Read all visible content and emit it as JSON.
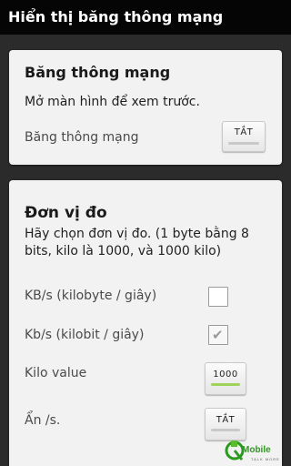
{
  "header": {
    "title": "Hiển thị băng thông mạng"
  },
  "bandwidth_card": {
    "title": "Băng thông mạng",
    "description": "Mở màn hình để xem trước.",
    "toggle_label": "Băng thông mạng",
    "toggle_button": "TẮT"
  },
  "units_card": {
    "title": "Đơn vị đo",
    "description": "Hãy chọn đơn vị đo. (1 byte bằng 8 bits, kilo là 1000, và 1000 kilo)",
    "rows": [
      {
        "label": "KB/s (kilobyte / giây)",
        "checked": false
      },
      {
        "label": "Kb/s (kilobit / giây)",
        "checked": true
      },
      {
        "label": "Kilo value",
        "value": "1000"
      },
      {
        "label": "Ẩn /s.",
        "value": "TẮT"
      }
    ]
  },
  "watermark": {
    "brand": "Mobile",
    "tagline": "TALK MORE"
  },
  "colors": {
    "titlebar": "#050505",
    "card": "#f2f2f2",
    "background": "#2b2b2b",
    "accent_green": "#9fd35a",
    "watermark_green": "#2c9a1e"
  },
  "icons": {
    "check": "check-icon",
    "logo": "logo-icon"
  }
}
